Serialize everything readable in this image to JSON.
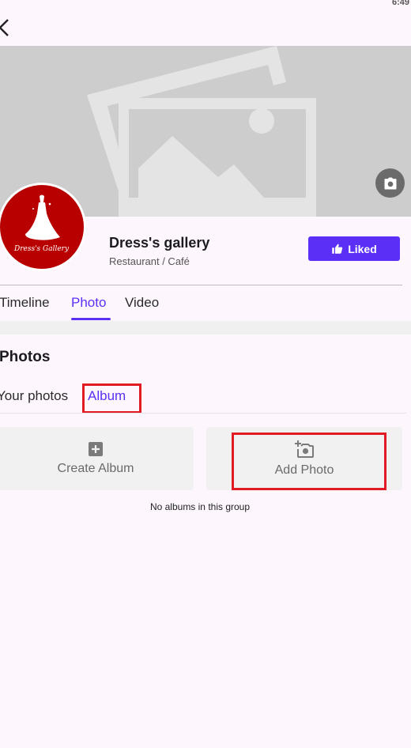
{
  "status_bar": {
    "time": "6:49"
  },
  "header": {
    "back_icon": "arrow-left-icon"
  },
  "cover": {
    "placeholder_icon": "image-placeholder-icon",
    "camera_icon": "camera-icon"
  },
  "profile": {
    "avatar_logo_text": "Dress's Gallery",
    "name": "Dress's gallery",
    "category": "Restaurant / Café",
    "liked_button": "Liked"
  },
  "tabs": [
    {
      "label": "Timeline",
      "active": false
    },
    {
      "label": "Photo",
      "active": true
    },
    {
      "label": "Video",
      "active": false
    }
  ],
  "photos_section": {
    "heading": "Photos",
    "subtabs": [
      {
        "label": "Your photos",
        "active": false
      },
      {
        "label": "Album",
        "active": true
      }
    ],
    "create_album_label": "Create Album",
    "add_photo_label": "Add Photo",
    "empty_message": "No albums in this group"
  },
  "colors": {
    "accent": "#5b2ff5",
    "highlight": "#e01b24",
    "avatar_bg": "#b80000",
    "background": "#fdf7fd"
  }
}
